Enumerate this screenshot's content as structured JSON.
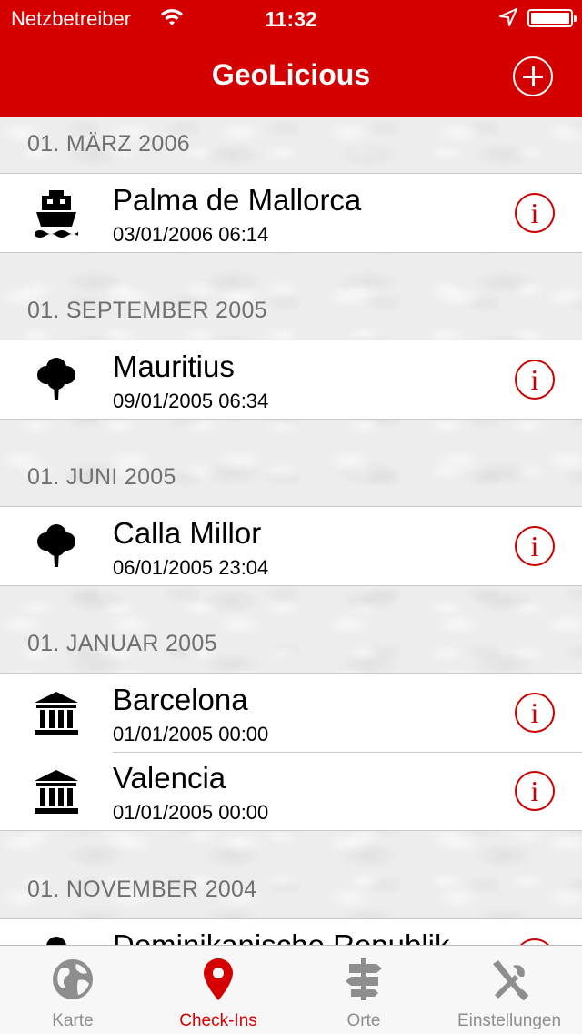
{
  "status_bar": {
    "carrier": "Netzbetreiber",
    "time": "11:32"
  },
  "nav": {
    "title": "GeoLicious"
  },
  "sections": [
    {
      "header": "01. MÄRZ 2006",
      "items": [
        {
          "icon": "ship-icon",
          "name": "Palma de Mallorca",
          "date": "03/01/2006 06:14"
        }
      ]
    },
    {
      "header": "01. SEPTEMBER 2005",
      "items": [
        {
          "icon": "tree-icon",
          "name": "Mauritius",
          "date": "09/01/2005 06:34"
        }
      ]
    },
    {
      "header": "01. JUNI 2005",
      "items": [
        {
          "icon": "tree-icon",
          "name": "Calla Millor",
          "date": "06/01/2005 23:04"
        }
      ]
    },
    {
      "header": "01. JANUAR 2005",
      "items": [
        {
          "icon": "museum-icon",
          "name": "Barcelona",
          "date": "01/01/2005 00:00"
        },
        {
          "icon": "museum-icon",
          "name": "Valencia",
          "date": "01/01/2005 00:00"
        }
      ]
    },
    {
      "header": "01. NOVEMBER 2004",
      "items": [
        {
          "icon": "tree-icon",
          "name": "Dominikanische Republik",
          "date": ""
        }
      ]
    }
  ],
  "info_label": "i",
  "tabs": [
    {
      "label": "Karte",
      "icon": "globe-icon",
      "active": false
    },
    {
      "label": "Check-Ins",
      "icon": "map-pin-icon",
      "active": true
    },
    {
      "label": "Orte",
      "icon": "signpost-icon",
      "active": false
    },
    {
      "label": "Einstellungen",
      "icon": "tools-icon",
      "active": false
    }
  ],
  "colors": {
    "brand_red": "#d40000",
    "tab_inactive": "#8e8e8e"
  }
}
